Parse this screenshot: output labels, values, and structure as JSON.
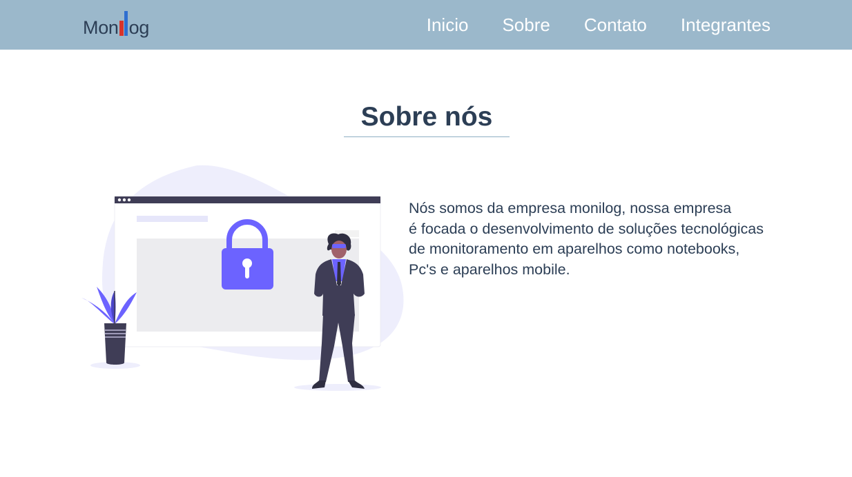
{
  "navbar": {
    "logo": {
      "text_left": "Mon",
      "text_right": "og"
    },
    "links": [
      {
        "label": "Inicio"
      },
      {
        "label": "Sobre"
      },
      {
        "label": "Contato"
      },
      {
        "label": "Integrantes"
      }
    ]
  },
  "main": {
    "title": "Sobre nós",
    "description_lines": [
      "Nós somos da empresa monilog, nossa empresa",
      "é focada o desenvolvimento de soluções tecnológicas",
      "de monitoramento em aparelhos como notebooks,",
      "Pc's e aparelhos mobile."
    ]
  },
  "colors": {
    "navbar": "#9bb8cb",
    "text": "#2c3e55",
    "accent_purple": "#6c63ff",
    "blob": "#eeeefc",
    "dark_suit": "#3f3d56"
  },
  "icons": [
    "padlock-icon",
    "plant-icon",
    "person-icon",
    "browser-window-icon"
  ]
}
